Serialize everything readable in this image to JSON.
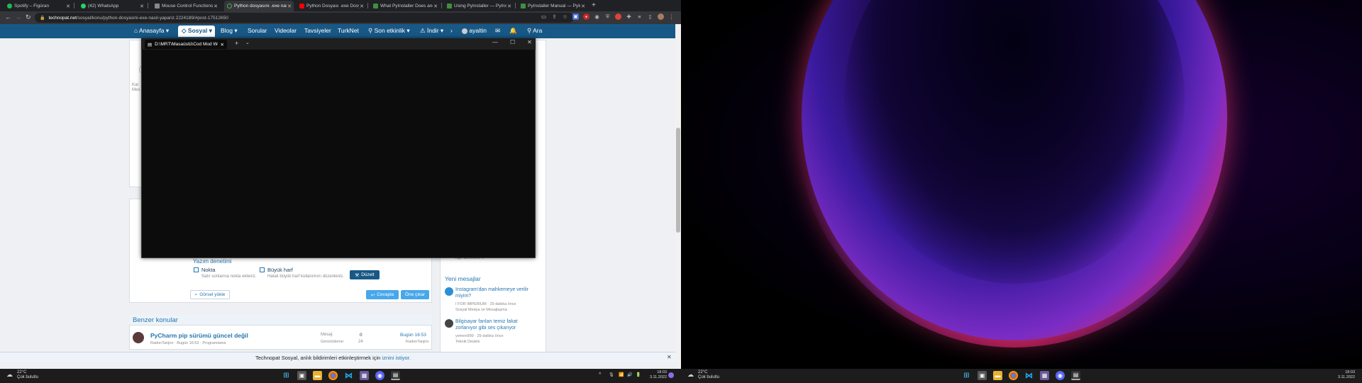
{
  "browser": {
    "tabs": [
      {
        "title": "Spotify – Figüran",
        "color": "#1db954"
      },
      {
        "title": "(42) WhatsApp",
        "color": "#25d366"
      },
      {
        "title": "Mouse Control Functions",
        "color": "#888888"
      },
      {
        "title": "Python dosyasını .exe nasıl",
        "color": "#4caf50"
      },
      {
        "title": "Python Dosyası .exe Dosya",
        "color": "#ff0000"
      },
      {
        "title": "What PyInstaller Does and",
        "color": "#3f8f3f"
      },
      {
        "title": "Using PyInstaller — PyInst",
        "color": "#3f8f3f"
      },
      {
        "title": "PyInstaller Manual — PyIn",
        "color": "#3f8f3f"
      }
    ],
    "new_tab": "+",
    "window_buttons": [
      "⌄",
      "—",
      "☐",
      "✕"
    ],
    "url_host": "technopat.net",
    "url_path": "/sosyal/konu/python-dosyasini-exe-nasil-yapariz.2224189/#post-17512650",
    "ext_icons": [
      "document-icon",
      "share-icon",
      "star-icon",
      "ext-red-icon",
      "ext-gray-icon",
      "ext-shield-icon",
      "ext-chrome-icon",
      "puzzle-icon",
      "menu-icon",
      "sidebar-icon",
      "profile-icon",
      "kebab-icon"
    ]
  },
  "site": {
    "nav": {
      "anasayfa": "Anasayfa",
      "sosyal": "Sosyal",
      "blog": "Blog",
      "sorular": "Sorular",
      "videolar": "Videolar",
      "tavsiyeler": "Tavsiyeler",
      "turknet": "TurkNet",
      "son_etkinlik": "Son etkinlik",
      "indir": "İndir",
      "user": "ayaltin",
      "ara": "Ara"
    },
    "post_side_left": [
      "Kat",
      "Mes"
    ],
    "editor": {
      "section_title": "Yazım denetimi",
      "nokta_label": "Nokta",
      "nokta_desc": "Satır sonlarına nokta ekleniz.",
      "buyuk_label": "Büyük harf",
      "buyuk_desc": "Hatalı büyük harf kullanımını düzenleniz.",
      "duzelt": "Düzelt",
      "gorsel": "Görsel yükle",
      "cevapla": "Cevapla",
      "one_cikar": "Öne çıkar"
    },
    "benzer": {
      "title": "Benzer konular",
      "item_title": "PyCharm pip sürümü güncel değil",
      "item_meta": "RadonTanjiro · Bugün 16:53 · Programlama",
      "mesaj_label": "Mesaj:",
      "mesaj_value": "0",
      "goruntuleme_label": "Görüntüleme:",
      "goruntuleme_value": "24",
      "last_time": "Bugün 16:53",
      "last_user": "RadonTanjiro"
    },
    "sidebar_top_snippet": "Yapı denetimi ...",
    "yeni_mesajlar": {
      "title": "Yeni mesajlar",
      "items": [
        {
          "title_line1": "Instagram'dan mahkemeye verilir",
          "title_line2": "miyim?",
          "meta1": "I FOR IMPERIUM · 29 dakika önce",
          "meta2": "Sosyal Medya ve Mesajlaşma"
        },
        {
          "title_line1": "Bilgisayar fanları temiz fakat",
          "title_line2": "zorlanıyor gibi ses çıkarıyor",
          "meta1": "yemen999 · 29 dakika önce",
          "meta2": "Teknik Destek"
        }
      ]
    },
    "notification": {
      "text": "Technopat Sosyal, anlık bildirimleri etkinleştirmek için",
      "link": "iznini istiyor.",
      "close": "✕"
    }
  },
  "terminal": {
    "tab_title": "D:\\MRT\\Masaüstü\\Cod Mod Wo",
    "new_tab": "+",
    "dropdown": "⌄",
    "buttons": [
      "—",
      "☐",
      "✕"
    ]
  },
  "taskbar_left": {
    "temp": "22°C",
    "weather": "Çok bulutlu",
    "time": "18:03",
    "date": "3.11.2022",
    "tray": [
      "^",
      "🎙",
      "📶",
      "🔊",
      "🔋"
    ]
  },
  "taskbar_right": {
    "temp": "22°C",
    "weather": "Çok bulutlu",
    "time": "18:03",
    "date": "3.11.2022"
  }
}
